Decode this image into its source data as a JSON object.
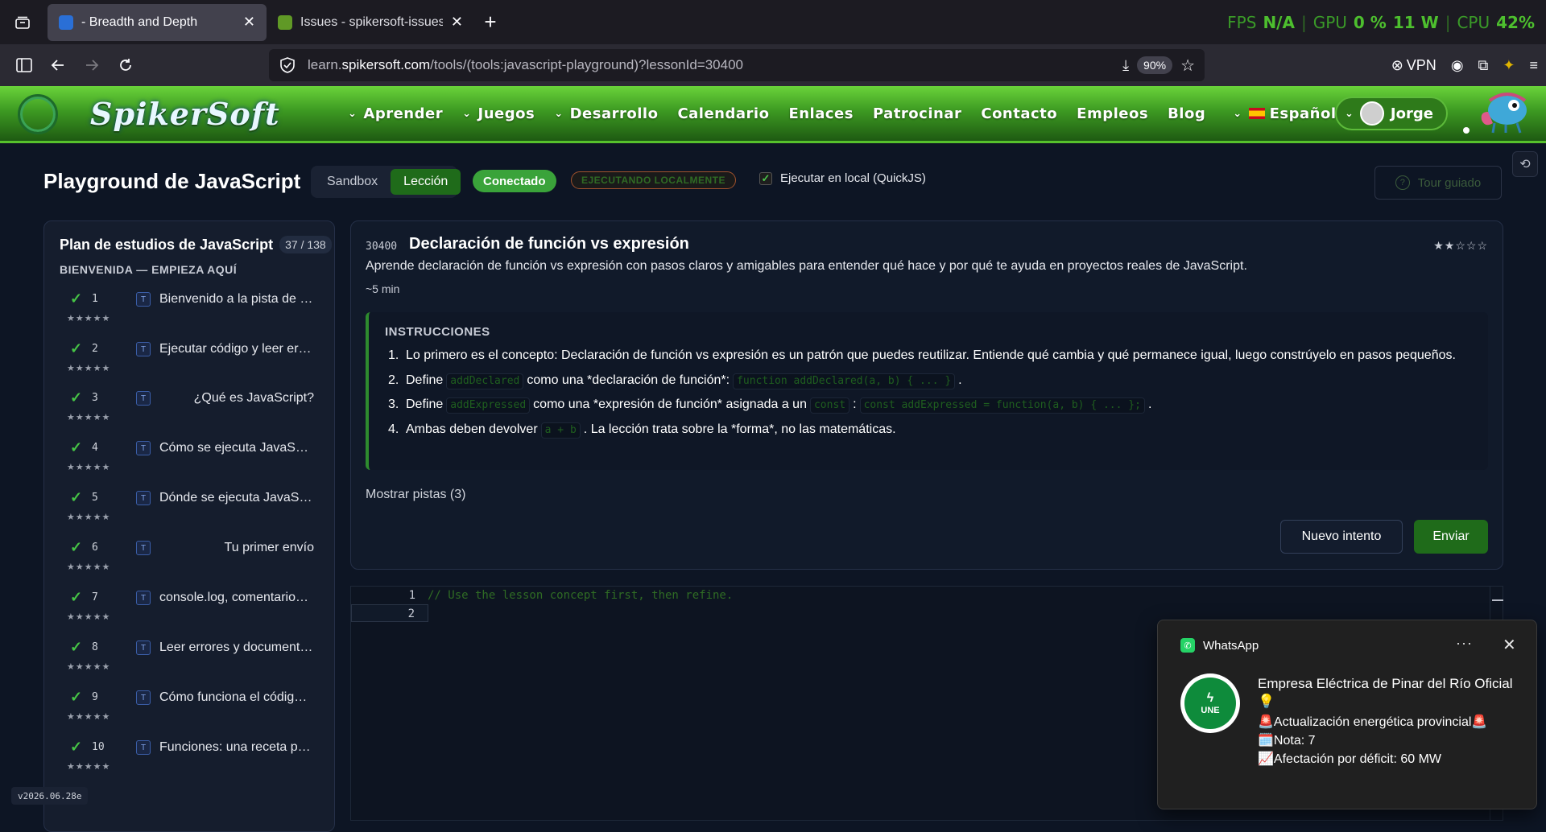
{
  "browser": {
    "tabs": [
      {
        "title": "- Breadth and Depth",
        "active": true
      },
      {
        "title": "Issues - spikersoft-issues - Gitea",
        "active": false
      }
    ],
    "perf": {
      "fps_label": "FPS",
      "fps_value": "N/A",
      "gpu_label": "GPU",
      "gpu_value": "0 %",
      "power": "11 W",
      "cpu_label": "CPU",
      "cpu_value": "42%"
    },
    "url_prefix": "learn.",
    "url_domain": "spikersoft.com",
    "url_path": "/tools/(tools:javascript-playground)?lessonId=30400",
    "zoom": "90%",
    "vpn": "VPN"
  },
  "site": {
    "logo": "SpikerSoft",
    "nav": [
      {
        "label": "Aprender",
        "dropdown": true
      },
      {
        "label": "Juegos",
        "dropdown": true
      },
      {
        "label": "Desarrollo",
        "dropdown": true
      },
      {
        "label": "Calendario",
        "dropdown": false
      },
      {
        "label": "Enlaces",
        "dropdown": false
      },
      {
        "label": "Patrocinar",
        "dropdown": false
      },
      {
        "label": "Contacto",
        "dropdown": false
      },
      {
        "label": "Empleos",
        "dropdown": false
      },
      {
        "label": "Blog",
        "dropdown": false
      }
    ],
    "language": "Español",
    "user": "Jorge"
  },
  "playground": {
    "title": "Playground de JavaScript",
    "modes": [
      "Sandbox",
      "Lección"
    ],
    "active_mode": "Lección",
    "connected": "Conectado",
    "local_badge": "EJECUTANDO LOCALMENTE",
    "run_local_label": "Ejecutar en local (QuickJS)",
    "run_local_checked": true,
    "tour": "Tour guiado"
  },
  "sidebar": {
    "title": "Plan de estudios de JavaScript",
    "count": "37 / 138",
    "section": "BIENVENIDA — EMPIEZA AQUÍ",
    "lessons": [
      {
        "num": "1",
        "tag": "T",
        "title": "Bienvenido a la pista de JavaScript",
        "stars": "★★★★★"
      },
      {
        "num": "2",
        "tag": "T",
        "title": "Ejecutar código y leer errores",
        "stars": "★★★★★"
      },
      {
        "num": "3",
        "tag": "T",
        "title": "¿Qué es JavaScript?",
        "stars": "★★★★★"
      },
      {
        "num": "4",
        "tag": "T",
        "title": "Cómo se ejecuta JavaScript",
        "stars": "★★★★★"
      },
      {
        "num": "5",
        "tag": "T",
        "title": "Dónde se ejecuta JavaScript",
        "stars": "★★★★★"
      },
      {
        "num": "6",
        "tag": "T",
        "title": "Tu primer envío",
        "stars": "★★★★★"
      },
      {
        "num": "7",
        "tag": "T",
        "title": "console.log, comentarios y más",
        "stars": "★★★★★"
      },
      {
        "num": "8",
        "tag": "T",
        "title": "Leer errores y documentación",
        "stars": "★★★★★"
      },
      {
        "num": "9",
        "tag": "T",
        "title": "Cómo funciona el código JavaScript",
        "stars": "★★★★★"
      },
      {
        "num": "10",
        "tag": "T",
        "title": "Funciones: una receta para reutilizar",
        "stars": "★★★★★"
      }
    ]
  },
  "lesson": {
    "id": "30400",
    "title": "Declaración de función vs expresión",
    "stars": "★★☆☆☆",
    "description": "Aprende declaración de función vs expresión con pasos claros y amigables para entender qué hace y por qué te ayuda en proyectos reales de JavaScript.",
    "time": "~5 min",
    "instructions_heading": "INSTRUCCIONES",
    "steps": {
      "s1": "Lo primero es el concepto: Declaración de función vs expresión es un patrón que puedes reutilizar. Entiende qué cambia y qué permanece igual, luego constrúyelo en pasos pequeños.",
      "s2a": "Define",
      "s2code1": "addDeclared",
      "s2b": "como una *declaración de función*:",
      "s2code2": "function addDeclared(a, b) { ... }",
      "s2c": ".",
      "s3a": "Define",
      "s3code1": "addExpressed",
      "s3b": "como una *expresión de función* asignada a un",
      "s3code2": "const",
      "s3c": ":",
      "s3code3": "const addExpressed = function(a, b) { ... };",
      "s3d": ".",
      "s4a": "Ambas deben devolver",
      "s4code": "a + b",
      "s4b": ". La lección trata sobre la *forma*, no las matemáticas."
    },
    "hints": "Mostrar pistas (3)",
    "retry": "Nuevo intento",
    "submit": "Enviar"
  },
  "editor": {
    "line1": "1",
    "line2": "2",
    "code_line1": "// Use the lesson concept first, then refine."
  },
  "version": "v2026.06.28e",
  "notification": {
    "app": "WhatsApp",
    "logo_text": "UNE",
    "sender": "Empresa Eléctrica de Pinar del Río Oficial 💡",
    "lines": [
      "🚨Actualización energética provincial🚨",
      "🗓️Nota: 7",
      "📈Afectación por déficit: 60 MW"
    ]
  },
  "colors": {
    "accent_green": "#1f6b1a",
    "connected_green": "#3aa33a",
    "header_green": "#3d9a22",
    "background": "#0d1524"
  }
}
